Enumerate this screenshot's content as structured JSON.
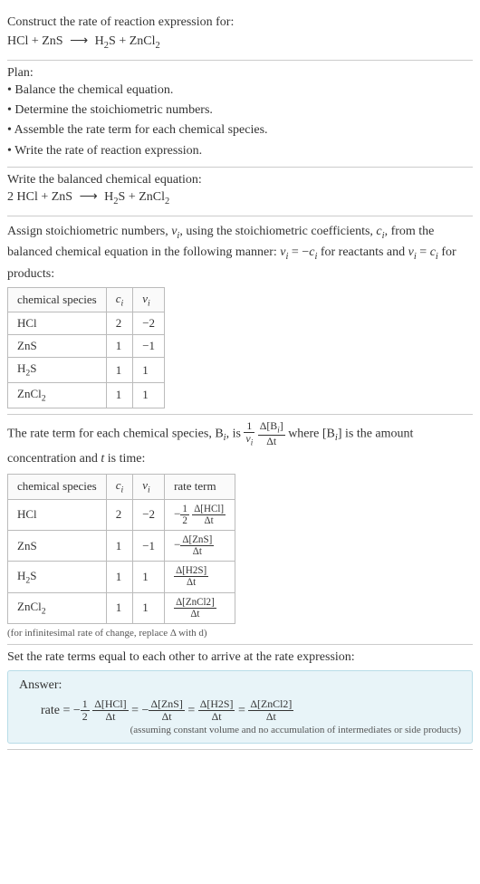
{
  "prompt": {
    "title": "Construct the rate of reaction expression for:",
    "equation_lhs1": "HCl",
    "equation_lhs2": "ZnS",
    "equation_rhs1": "H",
    "equation_rhs1_sub": "2",
    "equation_rhs1b": "S",
    "equation_rhs2": "ZnCl",
    "equation_rhs2_sub": "2"
  },
  "plan": {
    "label": "Plan:",
    "items": [
      "Balance the chemical equation.",
      "Determine the stoichiometric numbers.",
      "Assemble the rate term for each chemical species.",
      "Write the rate of reaction expression."
    ]
  },
  "balanced": {
    "title": "Write the balanced chemical equation:",
    "coef1": "2",
    "sp1": "HCl",
    "sp2": "ZnS",
    "sp3a": "H",
    "sp3sub": "2",
    "sp3b": "S",
    "sp4a": "ZnCl",
    "sp4sub": "2"
  },
  "stoich": {
    "intro1": "Assign stoichiometric numbers, ",
    "nu": "ν",
    "nusub": "i",
    "intro2": ", using the stoichiometric coefficients, ",
    "c": "c",
    "csub": "i",
    "intro3": ", from the balanced chemical equation in the following manner: ",
    "rel1a": "ν",
    "rel1b": "i",
    "rel1c": " = −",
    "rel1d": "c",
    "rel1e": "i",
    "intro4": " for reactants and ",
    "rel2a": "ν",
    "rel2b": "i",
    "rel2c": " = ",
    "rel2d": "c",
    "rel2e": "i",
    "intro5": " for products:",
    "headers": {
      "species": "chemical species",
      "ci": "c",
      "ci_sub": "i",
      "nui": "ν",
      "nui_sub": "i"
    },
    "rows": [
      {
        "species": "HCl",
        "c": "2",
        "nu": "−2"
      },
      {
        "species": "ZnS",
        "c": "1",
        "nu": "−1"
      },
      {
        "species_a": "H",
        "species_sub": "2",
        "species_b": "S",
        "c": "1",
        "nu": "1"
      },
      {
        "species_a": "ZnCl",
        "species_sub": "2",
        "species_b": "",
        "c": "1",
        "nu": "1"
      }
    ]
  },
  "rateterm": {
    "intro1": "The rate term for each chemical species, B",
    "intro1sub": "i",
    "intro2": ", is ",
    "frac1_num": "1",
    "frac1_den_a": "ν",
    "frac1_den_sub": "i",
    "frac2_num": "Δ[B",
    "frac2_num_sub": "i",
    "frac2_num_b": "]",
    "frac2_den": "Δt",
    "intro3": " where [B",
    "intro3sub": "i",
    "intro4": "] is the amount concentration and ",
    "t": "t",
    "intro5": " is time:",
    "headers": {
      "species": "chemical species",
      "ci": "c",
      "ci_sub": "i",
      "nui": "ν",
      "nui_sub": "i",
      "rate": "rate term"
    },
    "rows": [
      {
        "species": "HCl",
        "c": "2",
        "nu": "−2",
        "neg": "−",
        "coef_num": "1",
        "coef_den": "2",
        "delta_num": "Δ[HCl]",
        "delta_den": "Δt"
      },
      {
        "species": "ZnS",
        "c": "1",
        "nu": "−1",
        "neg": "−",
        "coef_num": "",
        "coef_den": "",
        "delta_num": "Δ[ZnS]",
        "delta_den": "Δt"
      },
      {
        "species_a": "H",
        "species_sub": "2",
        "species_b": "S",
        "c": "1",
        "nu": "1",
        "neg": "",
        "coef_num": "",
        "coef_den": "",
        "delta_num": "Δ[H2S]",
        "delta_den": "Δt"
      },
      {
        "species_a": "ZnCl",
        "species_sub": "2",
        "species_b": "",
        "c": "1",
        "nu": "1",
        "neg": "",
        "coef_num": "",
        "coef_den": "",
        "delta_num": "Δ[ZnCl2]",
        "delta_den": "Δt"
      }
    ],
    "note": "(for infinitesimal rate of change, replace Δ with d)"
  },
  "final": {
    "title": "Set the rate terms equal to each other to arrive at the rate expression:"
  },
  "answer": {
    "label": "Answer:",
    "rate_label": "rate = ",
    "t1_neg": "−",
    "t1_coef_num": "1",
    "t1_coef_den": "2",
    "t1_num": "Δ[HCl]",
    "t1_den": "Δt",
    "eq": " = ",
    "t2_neg": "−",
    "t2_num": "Δ[ZnS]",
    "t2_den": "Δt",
    "t3_num": "Δ[H2S]",
    "t3_den": "Δt",
    "t4_num": "Δ[ZnCl2]",
    "t4_den": "Δt",
    "note": "(assuming constant volume and no accumulation of intermediates or side products)"
  }
}
